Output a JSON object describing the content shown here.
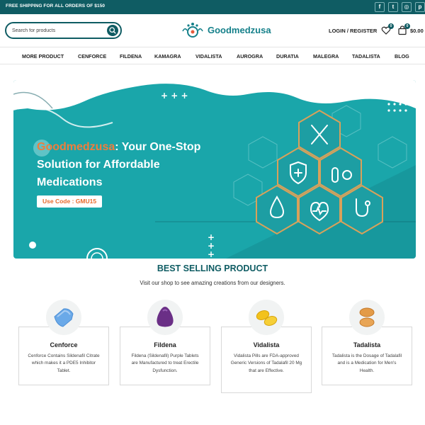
{
  "topbar": {
    "shipping_text": "FREE SHIPPING FOR ALL ORDERS OF $150",
    "social": [
      {
        "icon": "facebook-icon",
        "glyph": "f"
      },
      {
        "icon": "twitter-icon",
        "glyph": "t"
      },
      {
        "icon": "instagram-icon",
        "glyph": "◎"
      },
      {
        "icon": "pinterest-icon",
        "glyph": "p"
      }
    ]
  },
  "header": {
    "search_placeholder": "Search for products",
    "logo_text": "Goodmedzusa",
    "login_label": "LOGIN / REGISTER",
    "wishlist_count": "0",
    "cart_count": "0",
    "cart_total": "$0.00"
  },
  "nav": {
    "items": [
      "MORE PRODUCT",
      "CENFORCE",
      "FILDENA",
      "KAMAGRA",
      "VIDALISTA",
      "AUROGRA",
      "DURATIA",
      "MALEGRA",
      "TADALISTA",
      "BLOG"
    ]
  },
  "banner": {
    "brand": "Goodmedzusa",
    "line1_rest": ": Your One-Stop",
    "line2": "Solution for Affordable",
    "line3": "Medications",
    "code": "Use Code : GMU15"
  },
  "section": {
    "title": "BEST SELLING PRODUCT",
    "subtitle": "Visit our shop to see amazing creations from our designers."
  },
  "products": [
    {
      "name": "Cenforce",
      "desc": "Cenforce Contains Sildenafil Citrate which makes it a PDE5 Inhibitor Tablet."
    },
    {
      "name": "Fildena",
      "desc": "Fildena (Sildenafil) Purple Tablets are Manufactured to treat Erectile Dysfunction."
    },
    {
      "name": "Vidalista",
      "desc": "Vidalista Pills are FDA-approved Generic Versions of Tadalafil 20 Mg that are Effective."
    },
    {
      "name": "Tadalista",
      "desc": "Tadalista is the Dosage of Tadalafil and is a Medication for Men's Health."
    }
  ],
  "colors": {
    "brand_dark": "#0f5c63",
    "brand_teal": "#1aa6aa",
    "accent_orange": "#f07d3c"
  }
}
